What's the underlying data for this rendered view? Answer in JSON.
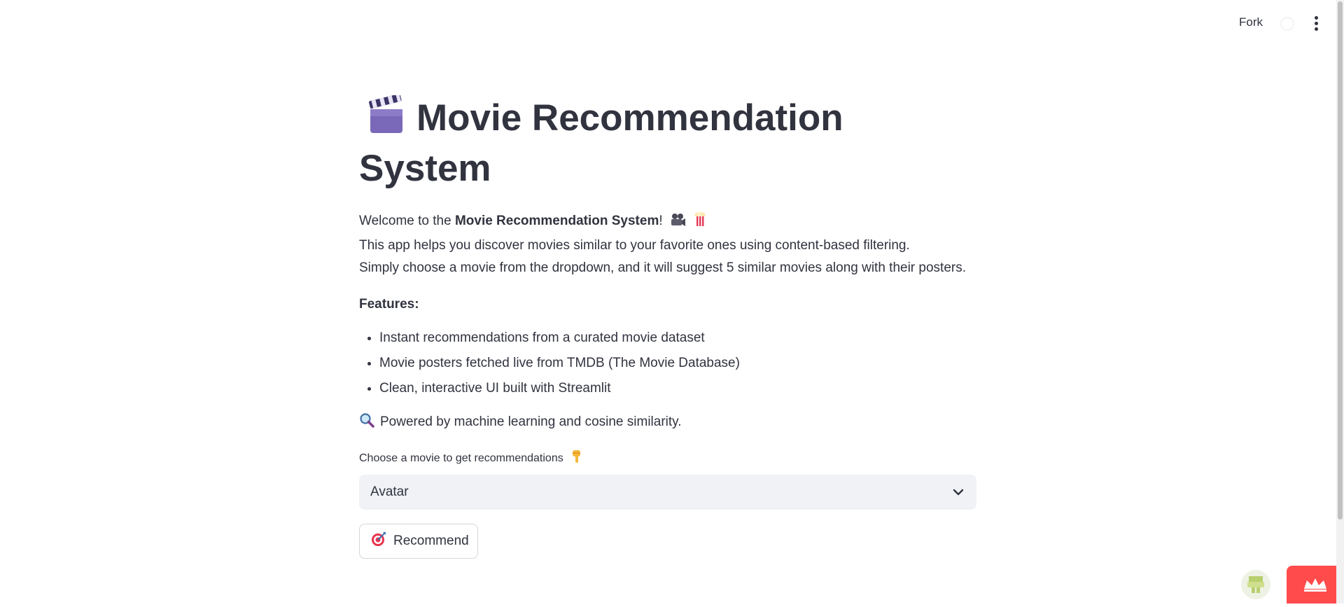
{
  "header": {
    "fork_label": "Fork"
  },
  "main": {
    "title": "Movie Recommendation System",
    "intro": {
      "welcome_prefix": "Welcome to the ",
      "welcome_bold": "Movie Recommendation System",
      "welcome_suffix": "!",
      "line2": "This app helps you discover movies similar to your favorite ones using content-based filtering.",
      "line3": "Simply choose a movie from the dropdown, and it will suggest 5 similar movies along with their posters."
    },
    "features_title": "Features:",
    "features": [
      "Instant recommendations from a curated movie dataset",
      "Movie posters fetched live from TMDB (The Movie Database)",
      "Clean, interactive UI built with Streamlit"
    ],
    "powered_by": "Powered by machine learning and cosine similarity.",
    "select": {
      "label": "Choose a movie to get recommendations",
      "value": "Avatar"
    },
    "recommend_label": "Recommend"
  },
  "icons": {
    "title": "clapper-board-icon",
    "intro": [
      "movie-camera-icon",
      "popcorn-icon"
    ],
    "powered": "magnifying-glass-icon",
    "select_label": "pointing-down-icon",
    "select": "chevron-down-icon",
    "button": "direct-hit-icon",
    "menu": "kebab-menu-icon"
  },
  "colors": {
    "text": "#31333f",
    "select_bg": "#f0f2f6",
    "accent": "#ff4b4b"
  }
}
